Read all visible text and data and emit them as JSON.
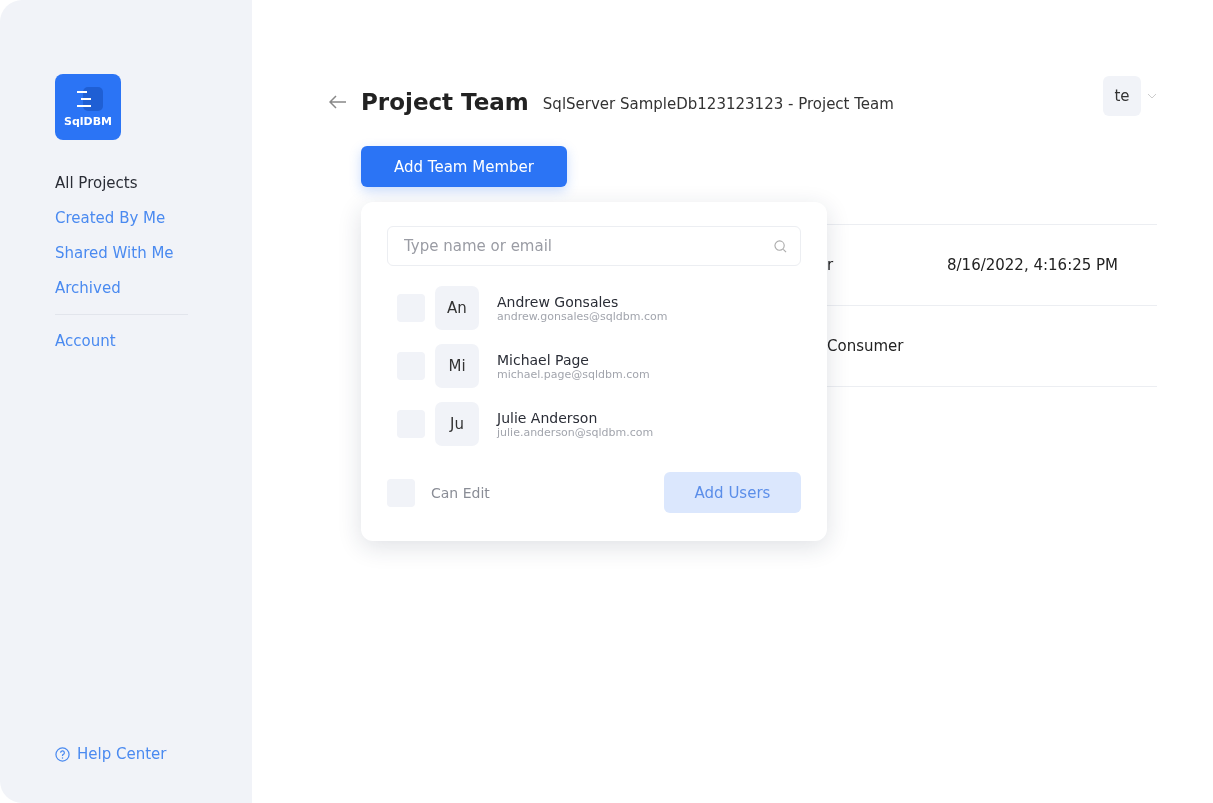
{
  "sidebar": {
    "logo": "SqlDBM",
    "items": [
      {
        "label": "All Projects",
        "selected": true
      },
      {
        "label": "Created By Me",
        "selected": false
      },
      {
        "label": "Shared With Me",
        "selected": false
      },
      {
        "label": "Archived",
        "selected": false
      }
    ],
    "account": "Account",
    "help": "Help Center"
  },
  "header": {
    "title": "Project Team",
    "subtitle": "SqlServer SampleDb123123123 - Project Team",
    "user": "te"
  },
  "add_button": "Add Team Member",
  "table": {
    "rows": [
      {
        "column_2": "r",
        "column_3": "8/16/2022, 4:16:25 PM"
      },
      {
        "column_2": "Consumer"
      }
    ]
  },
  "popup": {
    "search": {
      "placeholder": "Type name or email"
    },
    "people": [
      {
        "initials": "An",
        "name": "Andrew Gonsales",
        "email": "andrew.gonsales@sqldbm.com",
        "checked": false
      },
      {
        "initials": "Mi",
        "name": "Michael Page",
        "email": "michael.page@sqldbm.com",
        "checked": false
      },
      {
        "initials": "Ju",
        "name": "Julie Anderson",
        "email": "julie.anderson@sqldbm.com",
        "checked": false
      }
    ],
    "can_edit": {
      "label": "Can Edit",
      "checked": false
    },
    "submit": {
      "label": "Add Users",
      "disabled": true
    }
  }
}
